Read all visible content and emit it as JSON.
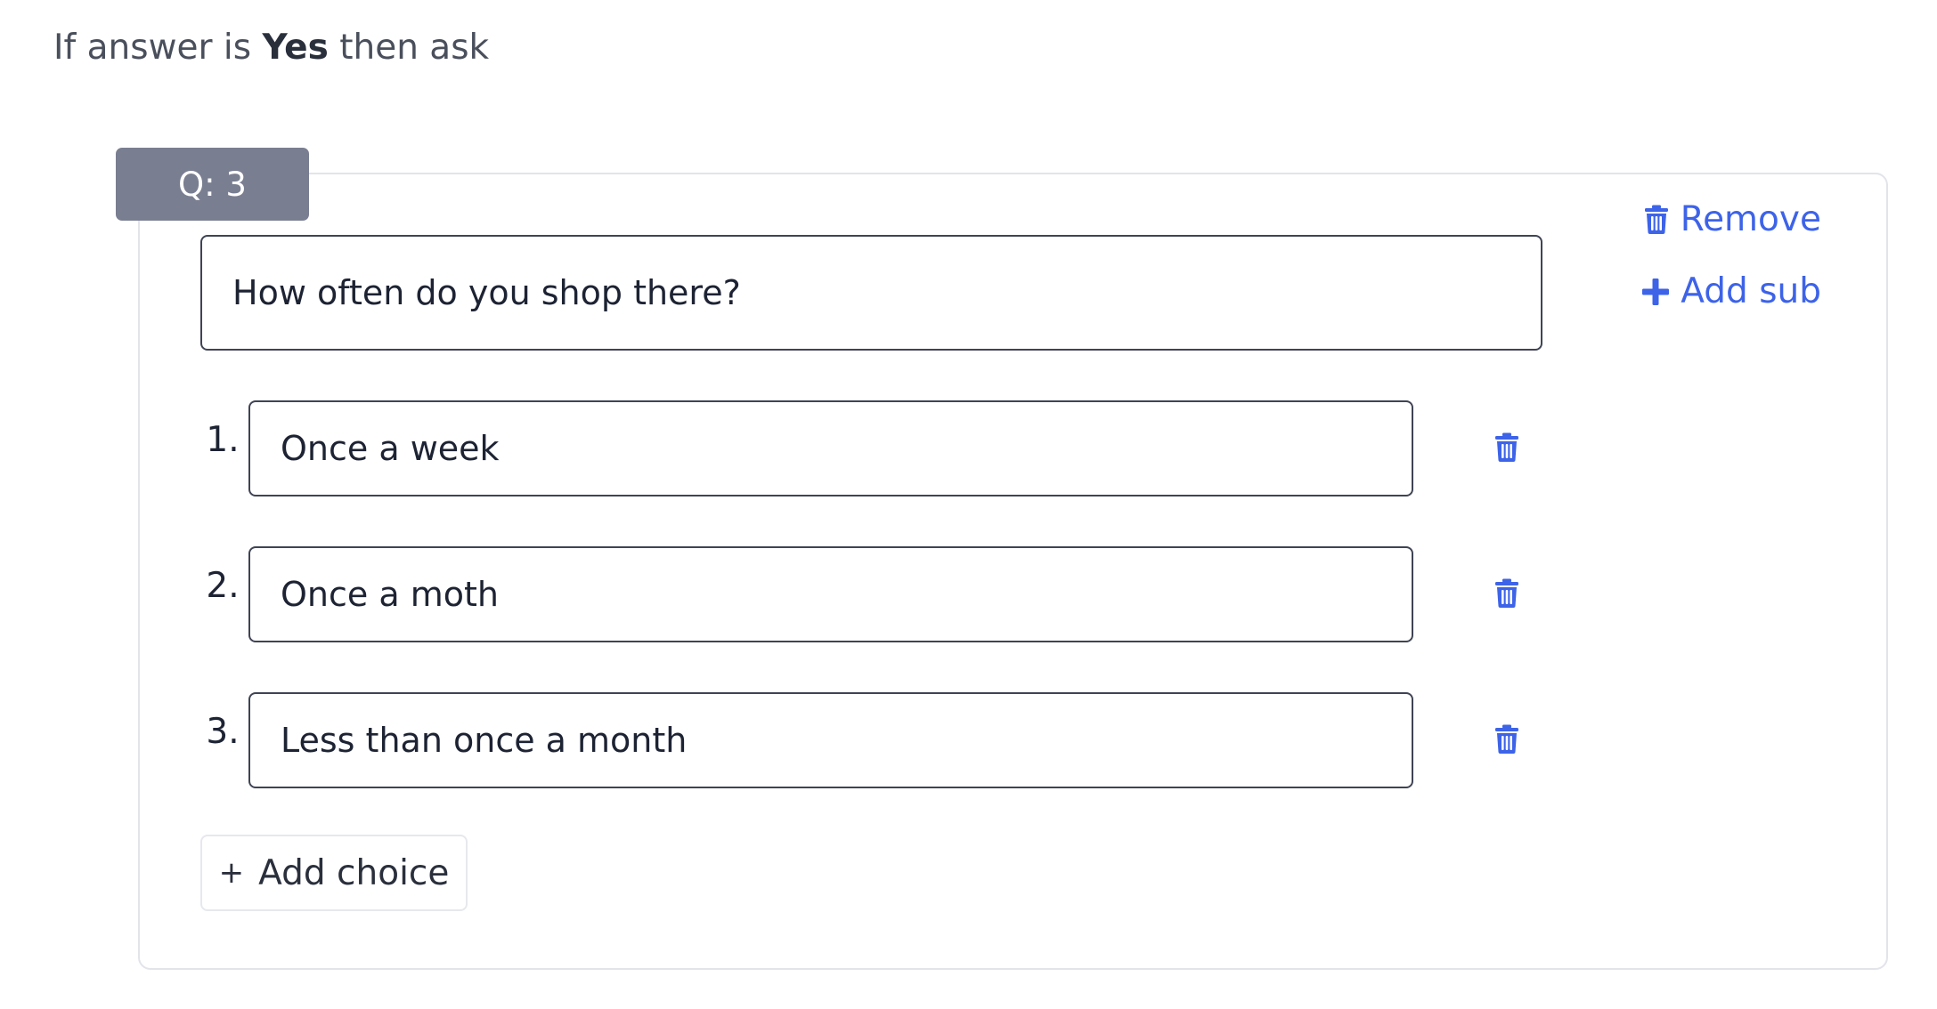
{
  "intro": {
    "prefix": "If answer is",
    "answer": "Yes",
    "suffix": "then ask"
  },
  "question": {
    "badge": "Q: 3",
    "text": "How often do you shop there?"
  },
  "actions": {
    "remove_label": "Remove",
    "add_sub_label": "Add sub",
    "remove_icon": "trash-icon",
    "add_sub_icon": "plus-icon"
  },
  "choices": [
    {
      "number": "1.",
      "value": "Once a week"
    },
    {
      "number": "2.",
      "value": "Once a moth"
    },
    {
      "number": "3.",
      "value": "Less than once a month"
    }
  ],
  "add_choice": {
    "label": "Add choice",
    "icon": "plus"
  },
  "colors": {
    "accent": "#3d63e8",
    "badge_bg": "#7a7e91",
    "input_border": "#3f4454",
    "card_border": "#e2e4ea"
  }
}
